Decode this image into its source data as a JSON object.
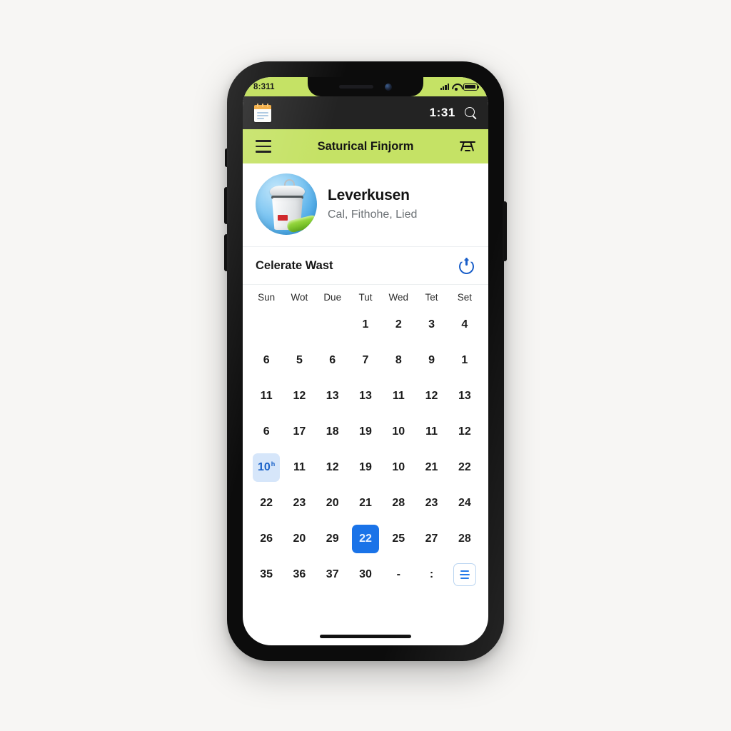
{
  "status_bar": {
    "time": "8:311",
    "signal_icon": "cellular-signal-icon",
    "wifi_icon": "wifi-icon",
    "battery_icon": "battery-icon"
  },
  "dark_bar": {
    "app_icon": "notepad-icon",
    "time": "1:31",
    "search_icon": "search-icon"
  },
  "green_bar": {
    "menu_icon": "hamburger-menu-icon",
    "title": "Saturical Finjorm",
    "filter_icon": "filter-icon",
    "background_color": "#c5e265"
  },
  "profile": {
    "avatar_icon": "trash-bin-avatar",
    "title": "Leverkusen",
    "subtitle": "Cal, Fithohe, Lied"
  },
  "section": {
    "title": "Celerate Wast",
    "power_icon": "power-icon",
    "power_color": "#1a5fc9"
  },
  "calendar": {
    "day_headers": [
      "Sun",
      "Wot",
      "Due",
      "Tut",
      "Wed",
      "Tet",
      "Set"
    ],
    "today_color": "#d6e6fa",
    "selected_color": "#1a73e8",
    "rows": [
      [
        {
          "label": "",
          "state": "empty"
        },
        {
          "label": "",
          "state": "empty"
        },
        {
          "label": "",
          "state": "empty"
        },
        {
          "label": "1",
          "state": "normal"
        },
        {
          "label": "2",
          "state": "normal"
        },
        {
          "label": "3",
          "state": "normal"
        },
        {
          "label": "4",
          "state": "normal"
        }
      ],
      [
        {
          "label": "6",
          "state": "normal"
        },
        {
          "label": "5",
          "state": "normal"
        },
        {
          "label": "6",
          "state": "normal"
        },
        {
          "label": "7",
          "state": "normal"
        },
        {
          "label": "8",
          "state": "normal"
        },
        {
          "label": "9",
          "state": "normal"
        },
        {
          "label": "1",
          "state": "normal"
        }
      ],
      [
        {
          "label": "11",
          "state": "normal"
        },
        {
          "label": "12",
          "state": "normal"
        },
        {
          "label": "13",
          "state": "normal"
        },
        {
          "label": "13",
          "state": "normal"
        },
        {
          "label": "11",
          "state": "normal"
        },
        {
          "label": "12",
          "state": "normal"
        },
        {
          "label": "13",
          "state": "normal"
        }
      ],
      [
        {
          "label": "6",
          "state": "normal"
        },
        {
          "label": "17",
          "state": "normal"
        },
        {
          "label": "18",
          "state": "normal"
        },
        {
          "label": "19",
          "state": "normal"
        },
        {
          "label": "10",
          "state": "normal"
        },
        {
          "label": "11",
          "state": "normal"
        },
        {
          "label": "12",
          "state": "normal"
        }
      ],
      [
        {
          "label": "10",
          "state": "today",
          "superscript": "h"
        },
        {
          "label": "11",
          "state": "normal"
        },
        {
          "label": "12",
          "state": "normal"
        },
        {
          "label": "19",
          "state": "normal"
        },
        {
          "label": "10",
          "state": "normal"
        },
        {
          "label": "21",
          "state": "normal"
        },
        {
          "label": "22",
          "state": "normal"
        }
      ],
      [
        {
          "label": "22",
          "state": "normal"
        },
        {
          "label": "23",
          "state": "normal"
        },
        {
          "label": "20",
          "state": "normal"
        },
        {
          "label": "21",
          "state": "normal"
        },
        {
          "label": "28",
          "state": "normal"
        },
        {
          "label": "23",
          "state": "normal"
        },
        {
          "label": "24",
          "state": "normal"
        }
      ],
      [
        {
          "label": "26",
          "state": "normal"
        },
        {
          "label": "20",
          "state": "normal"
        },
        {
          "label": "29",
          "state": "normal"
        },
        {
          "label": "22",
          "state": "selected"
        },
        {
          "label": "25",
          "state": "normal"
        },
        {
          "label": "27",
          "state": "normal"
        },
        {
          "label": "28",
          "state": "normal"
        }
      ],
      [
        {
          "label": "35",
          "state": "normal"
        },
        {
          "label": "36",
          "state": "normal"
        },
        {
          "label": "37",
          "state": "normal"
        },
        {
          "label": "30",
          "state": "normal"
        },
        {
          "label": "-",
          "state": "normal"
        },
        {
          "label": ":",
          "state": "normal"
        },
        {
          "label": "",
          "state": "list-button"
        }
      ]
    ]
  }
}
